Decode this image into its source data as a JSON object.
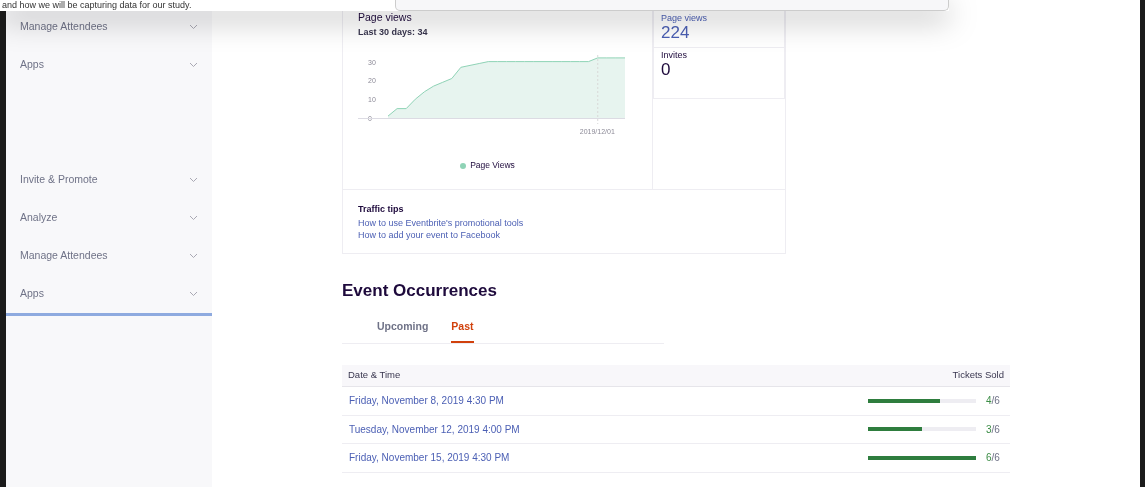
{
  "dialog": {
    "text": "and how we will be capturing data for our study."
  },
  "sidebar": {
    "groups": [
      {
        "items": [
          {
            "label": "Manage Attendees",
            "expanded": false
          },
          {
            "label": "Apps",
            "expanded": false
          }
        ]
      },
      {
        "items": [
          {
            "label": "Invite & Promote",
            "expanded": false
          },
          {
            "label": "Analyze",
            "expanded": false
          },
          {
            "label": "Manage Attendees",
            "expanded": false
          },
          {
            "label": "Apps",
            "expanded": false
          }
        ]
      }
    ]
  },
  "page_views_card": {
    "title": "Page views",
    "subtitle": "Last 30 days: 34",
    "chart_data": {
      "type": "area",
      "series": [
        {
          "name": "Page Views",
          "color": "#8fd3b6",
          "values": [
            1,
            5,
            5,
            10,
            14,
            17,
            19,
            21,
            27,
            28,
            29,
            30,
            30,
            30,
            30,
            30,
            30,
            30,
            30,
            30,
            30,
            30,
            30,
            32,
            32,
            32,
            32
          ]
        }
      ],
      "ylim": [
        0,
        33
      ],
      "yticks": [
        0,
        10,
        20,
        30
      ],
      "annotations": [
        "2019/12/01"
      ]
    }
  },
  "stats": [
    {
      "label": "Page views",
      "value": "224",
      "kind": "link"
    },
    {
      "label": "Invites",
      "value": "0",
      "kind": "plain"
    }
  ],
  "traffic_tips": {
    "title": "Traffic tips",
    "links": [
      "How to use Eventbrite's promotional tools",
      "How to add your event to Facebook"
    ]
  },
  "occurrences": {
    "title": "Event Occurrences",
    "tabs": [
      {
        "label": "Upcoming",
        "selected": false
      },
      {
        "label": "Past",
        "selected": true
      }
    ],
    "columns": [
      "Date & Time",
      "Tickets Sold"
    ],
    "rows": [
      {
        "date": "Friday, November 8, 2019 4:30 PM",
        "level": 0.667,
        "sold": "4",
        "of": "/6"
      },
      {
        "date": "Tuesday, November 12, 2019 4:00 PM",
        "level": 0.5,
        "sold": "3",
        "of": "/6"
      },
      {
        "date": "Friday, November 15, 2019 4:30 PM",
        "level": 1,
        "sold": "6",
        "of": "/6"
      }
    ]
  }
}
